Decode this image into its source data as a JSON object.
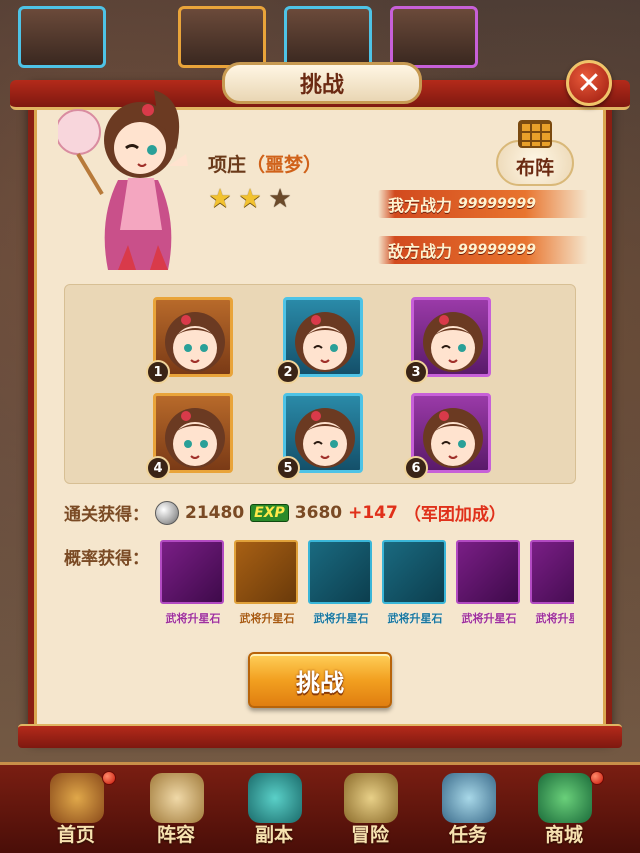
{
  "dialog": {
    "title": "挑战",
    "hero_name": "项庄",
    "hero_subtitle": "（噩梦）",
    "stars": [
      true,
      true,
      false
    ],
    "formation_label": "布阵",
    "my_power_label": "我方战力",
    "my_power_value": "99999999",
    "enemy_power_label": "敌方战力",
    "enemy_power_value": "99999999",
    "team_slots": [
      {
        "num": "1",
        "rarity": "gold"
      },
      {
        "num": "2",
        "rarity": "blue"
      },
      {
        "num": "3",
        "rarity": "purple"
      },
      {
        "num": "4",
        "rarity": "gold"
      },
      {
        "num": "5",
        "rarity": "blue"
      },
      {
        "num": "6",
        "rarity": "purple"
      }
    ],
    "clear_reward_label": "通关获得：",
    "silver_amount": "21480",
    "exp_label": "EXP",
    "exp_amount": "3680",
    "exp_bonus": "+147",
    "exp_bonus_note": "（军团加成）",
    "chance_reward_label": "概率获得：",
    "drops": [
      {
        "name": "武将升星石",
        "rarity": "purple"
      },
      {
        "name": "武将升星石",
        "rarity": "gold"
      },
      {
        "name": "武将升星石",
        "rarity": "blue"
      },
      {
        "name": "武将升星石",
        "rarity": "blue"
      },
      {
        "name": "武将升星石",
        "rarity": "purple"
      },
      {
        "name": "武将升星石",
        "rarity": "purple"
      }
    ],
    "challenge_button": "挑战"
  },
  "bottom_nav": [
    {
      "label": "首页",
      "icon": "home-icon"
    },
    {
      "label": "阵容",
      "icon": "lineup-icon"
    },
    {
      "label": "副本",
      "icon": "dungeon-icon"
    },
    {
      "label": "冒险",
      "icon": "adventure-icon"
    },
    {
      "label": "任务",
      "icon": "quest-icon"
    },
    {
      "label": "商城",
      "icon": "shop-icon"
    }
  ],
  "colors": {
    "dialog_border": "#8a1f13",
    "parchment": "#f5e6cd",
    "gold_rarity": "#e9a43a",
    "blue_rarity": "#4ec3e6",
    "purple_rarity": "#c760d8",
    "bonus_red": "#e0301a"
  }
}
